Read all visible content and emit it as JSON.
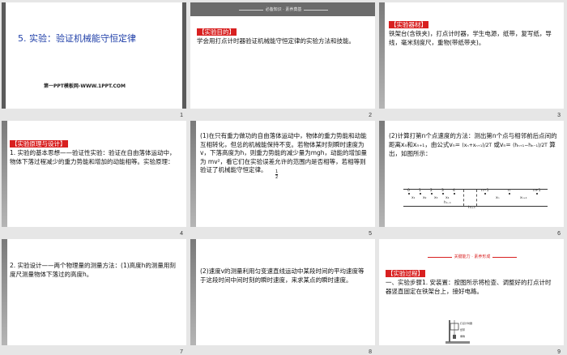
{
  "slides": [
    {
      "num": "1",
      "title": "5. 实验：验证机械能守恒定律",
      "footer": "第一PPT模板网-WWW.1PPT.COM"
    },
    {
      "num": "2",
      "ribbon": "必备知识 · 素养奠基",
      "tag": "【实验目的】",
      "body": "学会用打点计时器验证机械能守恒定律的实验方法和技能。"
    },
    {
      "num": "3",
      "tag": "【实验器材】",
      "body": "铁架台(含铁夹)，打点计时器，学生电源，纸带，复写纸，导线，毫米刻度尺，重物(带纸带夹)。"
    },
    {
      "num": "4",
      "tag": "【实验原理与设计】",
      "body": "1. 实验的基本思想——验证性实验：验证在自由落体运动中，物体下落过程减少的重力势能和增加的动能相等。实验原理："
    },
    {
      "num": "5",
      "body": "(1)在只有重力做功的自由落体运动中，物体的重力势能和动能互相转化，但总的机械能保持不变。若物体某时刻瞬时速度为v，下落高度为h，则重力势能的减少量为mgh，动能的增加量为  mv²，看它们在实验误差允许的范围内是否相等，若相等则验证了机械能守恒定律。",
      "half": "1",
      "half_den": "2"
    },
    {
      "num": "6",
      "body": "(2)计算打第n个点速度的方法：测出第n个点与相邻前后点间的距离xₙ和xₙ₊₁，由公式vₙ=",
      "formula1": "(xₙ+xₙ₊₁)/2T",
      "or": "或vₙ=",
      "formula2": "(hₙ₊₁−hₙ₋₁)/2T",
      "body2": "算出，如图所示：",
      "tape_labels": [
        "0",
        "1",
        "2",
        "3",
        "4",
        "n−1",
        "n",
        "n+1"
      ],
      "tape_x": [
        "x₁",
        "x₂",
        "x₃",
        "x₄",
        "xₙ",
        "xₙ₊₁"
      ],
      "tape_h": [
        "hₙ₋₁",
        "hₙ₊₁"
      ]
    },
    {
      "num": "7",
      "body": "2. 实验设计——两个物理量的测量方法：(1)高度h的测量用刻度尺测量物体下落过的高度h。"
    },
    {
      "num": "8",
      "body": "(2)速度v的测量利用匀变速直线运动中某段时间的平均速度等于这段时间中间时刻的瞬时速度，来求某点的瞬时速度。"
    },
    {
      "num": "9",
      "ribbon": "关键能力 · 素养形成",
      "tag": "【实验过程】",
      "body": "一、实验步骤1. 安装置：按图所示将检查、调整好的打点计时器竖直固定在铁架台上，接好电路。",
      "diagram_labels": [
        "打点计时器",
        "纸带",
        "重物"
      ]
    }
  ]
}
